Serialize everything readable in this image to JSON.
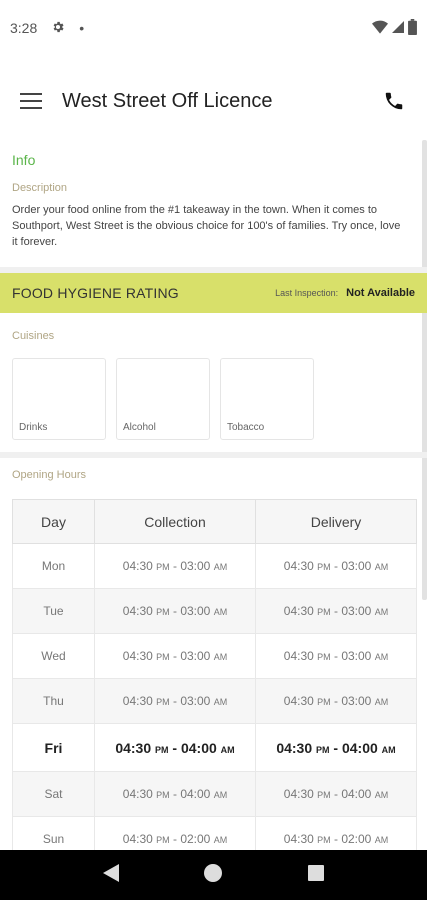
{
  "status_bar": {
    "time": "3:28",
    "dot": "•"
  },
  "app_bar": {
    "title": "West Street Off Licence"
  },
  "info": {
    "title": "Info",
    "description_label": "Description",
    "description": "Order your food online from the #1 takeaway in the town. When it comes to Southport, West Street is the obvious choice for 100's of families. Try once, love it forever."
  },
  "hygiene": {
    "title": "FOOD HYGIENE RATING",
    "last_inspection_label": "Last Inspection:",
    "last_inspection_value": "Not Available"
  },
  "cuisines": {
    "label": "Cuisines",
    "items": [
      "Drinks",
      "Alcohol",
      "Tobacco"
    ]
  },
  "opening_hours": {
    "label": "Opening Hours",
    "headers": [
      "Day",
      "Collection",
      "Delivery"
    ],
    "rows": [
      {
        "day": "Mon",
        "col_from": "04:30",
        "col_from_ampm": "PM",
        "col_to": "03:00",
        "col_to_ampm": "AM",
        "del_from": "04:30",
        "del_from_ampm": "PM",
        "del_to": "03:00",
        "del_to_ampm": "AM"
      },
      {
        "day": "Tue",
        "col_from": "04:30",
        "col_from_ampm": "PM",
        "col_to": "03:00",
        "col_to_ampm": "AM",
        "del_from": "04:30",
        "del_from_ampm": "PM",
        "del_to": "03:00",
        "del_to_ampm": "AM"
      },
      {
        "day": "Wed",
        "col_from": "04:30",
        "col_from_ampm": "PM",
        "col_to": "03:00",
        "col_to_ampm": "AM",
        "del_from": "04:30",
        "del_from_ampm": "PM",
        "del_to": "03:00",
        "del_to_ampm": "AM"
      },
      {
        "day": "Thu",
        "col_from": "04:30",
        "col_from_ampm": "PM",
        "col_to": "03:00",
        "col_to_ampm": "AM",
        "del_from": "04:30",
        "del_from_ampm": "PM",
        "del_to": "03:00",
        "del_to_ampm": "AM"
      },
      {
        "day": "Fri",
        "col_from": "04:30",
        "col_from_ampm": "PM",
        "col_to": "04:00",
        "col_to_ampm": "AM",
        "del_from": "04:30",
        "del_from_ampm": "PM",
        "del_to": "04:00",
        "del_to_ampm": "AM"
      },
      {
        "day": "Sat",
        "col_from": "04:30",
        "col_from_ampm": "PM",
        "col_to": "04:00",
        "col_to_ampm": "AM",
        "del_from": "04:30",
        "del_from_ampm": "PM",
        "del_to": "04:00",
        "del_to_ampm": "AM"
      },
      {
        "day": "Sun",
        "col_from": "04:30",
        "col_from_ampm": "PM",
        "col_to": "02:00",
        "col_to_ampm": "AM",
        "del_from": "04:30",
        "del_from_ampm": "PM",
        "del_to": "02:00",
        "del_to_ampm": "AM"
      }
    ]
  },
  "colors": {
    "info_green": "#5bb54a",
    "hygiene_bar": "#d8e06a",
    "label_tan": "#b0a584"
  },
  "icons": {
    "menu": "hamburger-menu-icon",
    "phone": "phone-icon",
    "settings": "gear-icon",
    "wifi": "wifi-icon",
    "signal": "signal-icon",
    "battery": "battery-icon",
    "back": "back-triangle-icon",
    "home": "home-circle-icon",
    "recents": "recents-square-icon"
  }
}
